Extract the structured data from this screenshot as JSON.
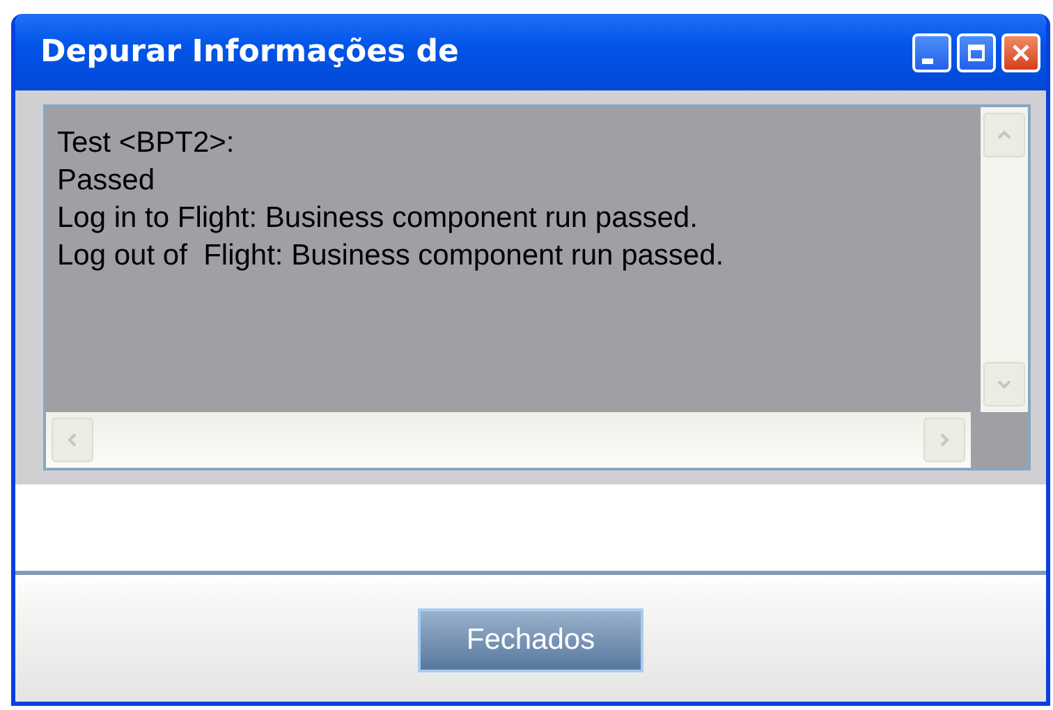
{
  "window": {
    "title": "Depurar Informações de"
  },
  "log": {
    "lines": [
      "Test <BPT2>:",
      "Passed",
      "Log in to Flight: Business component run passed.",
      "Log out of  Flight: Business component run passed."
    ]
  },
  "buttons": [
    {
      "label": "Fechados"
    }
  ]
}
